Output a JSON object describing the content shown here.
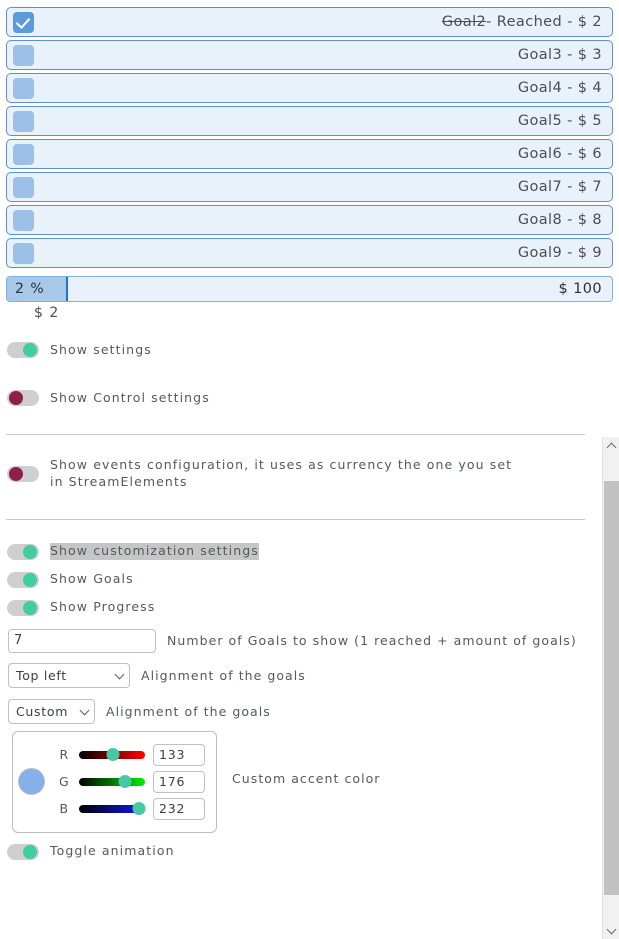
{
  "goals": [
    {
      "struck": "Goal2",
      "rest": "- Reached - $ 2",
      "checked": true
    },
    {
      "struck": "",
      "rest": "Goal3 - $ 3",
      "checked": false
    },
    {
      "struck": "",
      "rest": "Goal4 - $ 4",
      "checked": false
    },
    {
      "struck": "",
      "rest": "Goal5 - $ 5",
      "checked": false
    },
    {
      "struck": "",
      "rest": "Goal6 - $ 6",
      "checked": false
    },
    {
      "struck": "",
      "rest": "Goal7 - $ 7",
      "checked": false
    },
    {
      "struck": "",
      "rest": "Goal8 - $ 8",
      "checked": false
    },
    {
      "struck": "",
      "rest": "Goal9 - $ 9",
      "checked": false
    }
  ],
  "progress": {
    "percent_label": "2 %",
    "total_label": "$ 100",
    "current_label": "$ 2",
    "fill_percent": 2
  },
  "toggles": {
    "show_settings": {
      "label": "Show settings",
      "state": "on"
    },
    "show_control_settings": {
      "label": "Show Control settings",
      "state": "off"
    },
    "show_events_configuration": {
      "label": "Show events configuration, it uses as currency the one you set in StreamElements",
      "state": "off"
    },
    "show_customization_settings": {
      "label": "Show customization settings",
      "state": "on",
      "selected": true
    },
    "show_goals": {
      "label": "Show Goals",
      "state": "on"
    },
    "show_progress": {
      "label": "Show Progress",
      "state": "on"
    },
    "toggle_animation": {
      "label": "Toggle animation",
      "state": "on"
    }
  },
  "fields": {
    "number_of_goals": {
      "value": "7",
      "placeholder": "",
      "label": "Number of Goals to show (1 reached + amount of goals)"
    },
    "alignment_goals": {
      "value": "Top left",
      "label": "Alignment of the goals"
    },
    "alignment_goals_custom": {
      "value": "Custom",
      "label": "Alignment of the goals"
    }
  },
  "color_picker": {
    "caption": "Custom accent color",
    "swatch_hex": "#85b0e8",
    "channels": [
      {
        "name": "R",
        "value": "133",
        "pos": 52
      },
      {
        "name": "G",
        "value": "176",
        "pos": 69
      },
      {
        "name": "B",
        "value": "232",
        "pos": 91
      }
    ]
  },
  "scrollbar": {
    "up_icon": "chevron-up-icon",
    "down_icon": "chevron-down-icon"
  }
}
